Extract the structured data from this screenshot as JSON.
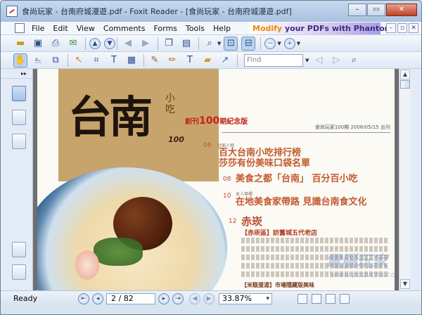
{
  "window": {
    "title": "食尚玩家 - 台南府城漫遊.pdf - Foxit Reader - [食尚玩家 - 台南府城漫遊.pdf]",
    "minimize": "–",
    "maximize": "▭",
    "close": "✕"
  },
  "menu": {
    "items": [
      "File",
      "Edit",
      "View",
      "Comments",
      "Forms",
      "Tools",
      "Help"
    ],
    "promo_highlight": "Modify",
    "promo_rest": " your PDFs with Phantom"
  },
  "toolbar": {
    "find_placeholder": "Find"
  },
  "document": {
    "big_title": "台南",
    "sub_title": "小吃",
    "sub_number": "100",
    "edition_prefix": "創刊",
    "edition_number": "100",
    "edition_suffix": "期紀念版",
    "date_line": "食尚玩家100期   2008/05/15 出刊",
    "toc": [
      {
        "num": "06",
        "tag": "封面人物",
        "lines": [
          "百大台南小吃排行榜",
          "莎莎有份美味口袋名單"
        ]
      },
      {
        "num": "08",
        "tag": "",
        "lines": [
          "美食之都「台南」 百分百小吃"
        ]
      },
      {
        "num": "10",
        "tag": "本人專欄",
        "lines": [
          "在地美食家帶路 見識台南食文化"
        ]
      }
    ],
    "section_num": "12",
    "section_title": "赤崁",
    "section_box": "【赤崁區】訪舊城五代老店",
    "section_box2": "【米糕蛋湯】市場隱藏版美味",
    "watermark": "電腦玩家",
    "watermark_url": "www.pcdvcns.com"
  },
  "status": {
    "ready": "Ready",
    "page": "2 / 82",
    "zoom": "33.87%"
  }
}
